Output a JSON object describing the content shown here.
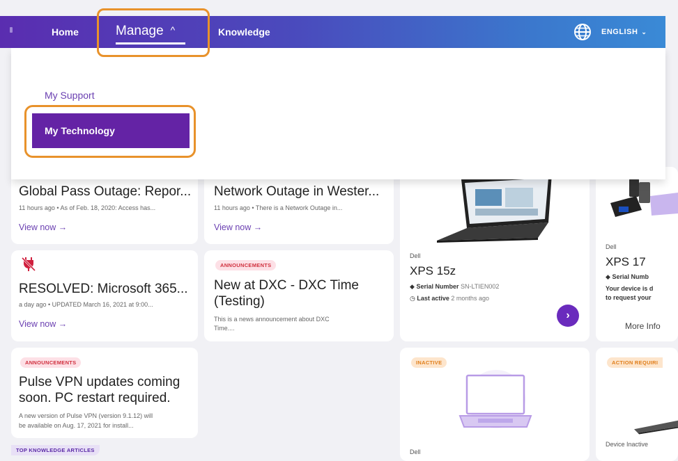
{
  "nav": {
    "home": "Home",
    "manage": "Manage",
    "manage_caret": "^",
    "knowledge": "Knowledge",
    "language": "ENGLISH",
    "language_chevron": "⌄",
    "globe_icon": "globe-icon"
  },
  "dropdown": {
    "my_support": "My Support",
    "my_technology": "My Technology"
  },
  "cards": {
    "global_pass": {
      "title": "Global Pass Outage: Repor...",
      "meta": "11 hours ago • As of Feb. 18, 2020: Access has...",
      "link": "View now →"
    },
    "network": {
      "title": "Network Outage in Wester...",
      "meta": "11 hours ago • There is a Network Outage in...",
      "link": "View now →"
    },
    "resolved": {
      "icon": "unplugged-icon",
      "title": "RESOLVED: Microsoft 365...",
      "meta": "a day ago • UPDATED March 16, 2021 at 9:00...",
      "link": "View now →"
    },
    "dxc_time": {
      "badge": "ANNOUNCEMENTS",
      "title_line1": "New at DXC - DXC Time",
      "title_line2": "(Testing)",
      "meta_line1": "This is a news announcement about DXC",
      "meta_line2": "Time...."
    },
    "pulse_vpn": {
      "badge": "ANNOUNCEMENTS",
      "title_line1": "Pulse VPN updates coming",
      "title_line2": "soon. PC restart required.",
      "meta_line1": "A new version of Pulse VPN (version 9.1.12) will",
      "meta_line2": "be available on Aug. 17, 2021 for install..."
    },
    "top_knowledge": "TOP KNOWLEDGE ARTICLES"
  },
  "devices": {
    "xps15": {
      "brand": "Dell",
      "model": "XPS 15z",
      "serial_label": "Serial Number",
      "serial_value": "SN-LTIEN002",
      "active_label": "Last active",
      "active_value": "2 months ago",
      "next": "›"
    },
    "xps17": {
      "brand": "Dell",
      "model": "XPS 17",
      "serial_label": "Serial Numb",
      "note_line1": "Your device is d",
      "note_line2": "to request your",
      "more": "More Info"
    },
    "inactive_laptop": {
      "badge": "INACTIVE",
      "brand": "Dell"
    },
    "action_required": {
      "badge": "ACTION REQUIRI",
      "status": "Device Inactive"
    }
  },
  "colors": {
    "nav_start": "#5a2db0",
    "nav_end": "#3a8ad6",
    "accent_purple": "#6423a5",
    "highlight_orange": "#e8922b"
  }
}
